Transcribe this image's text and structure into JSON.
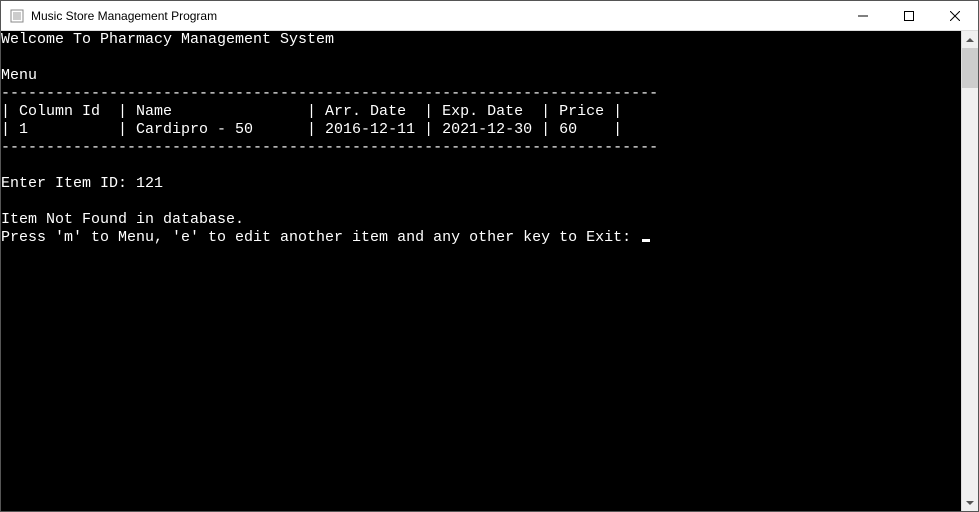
{
  "window": {
    "title": "Music Store Management Program"
  },
  "console": {
    "welcome": "Welcome To Pharmacy Management System",
    "menu_label": "Menu",
    "table_divider": "-------------------------------------------------------------------------",
    "table_header": "| Column Id  | Name               | Arr. Date  | Exp. Date  | Price |",
    "table_row1": "| 1          | Cardipro - 50      | 2016-12-11 | 2021-12-30 | 60    |",
    "prompt_enter": "Enter Item ID: 121",
    "not_found": "Item Not Found in database.",
    "prompt_options": "Press 'm' to Menu, 'e' to edit another item and any other key to Exit: "
  }
}
